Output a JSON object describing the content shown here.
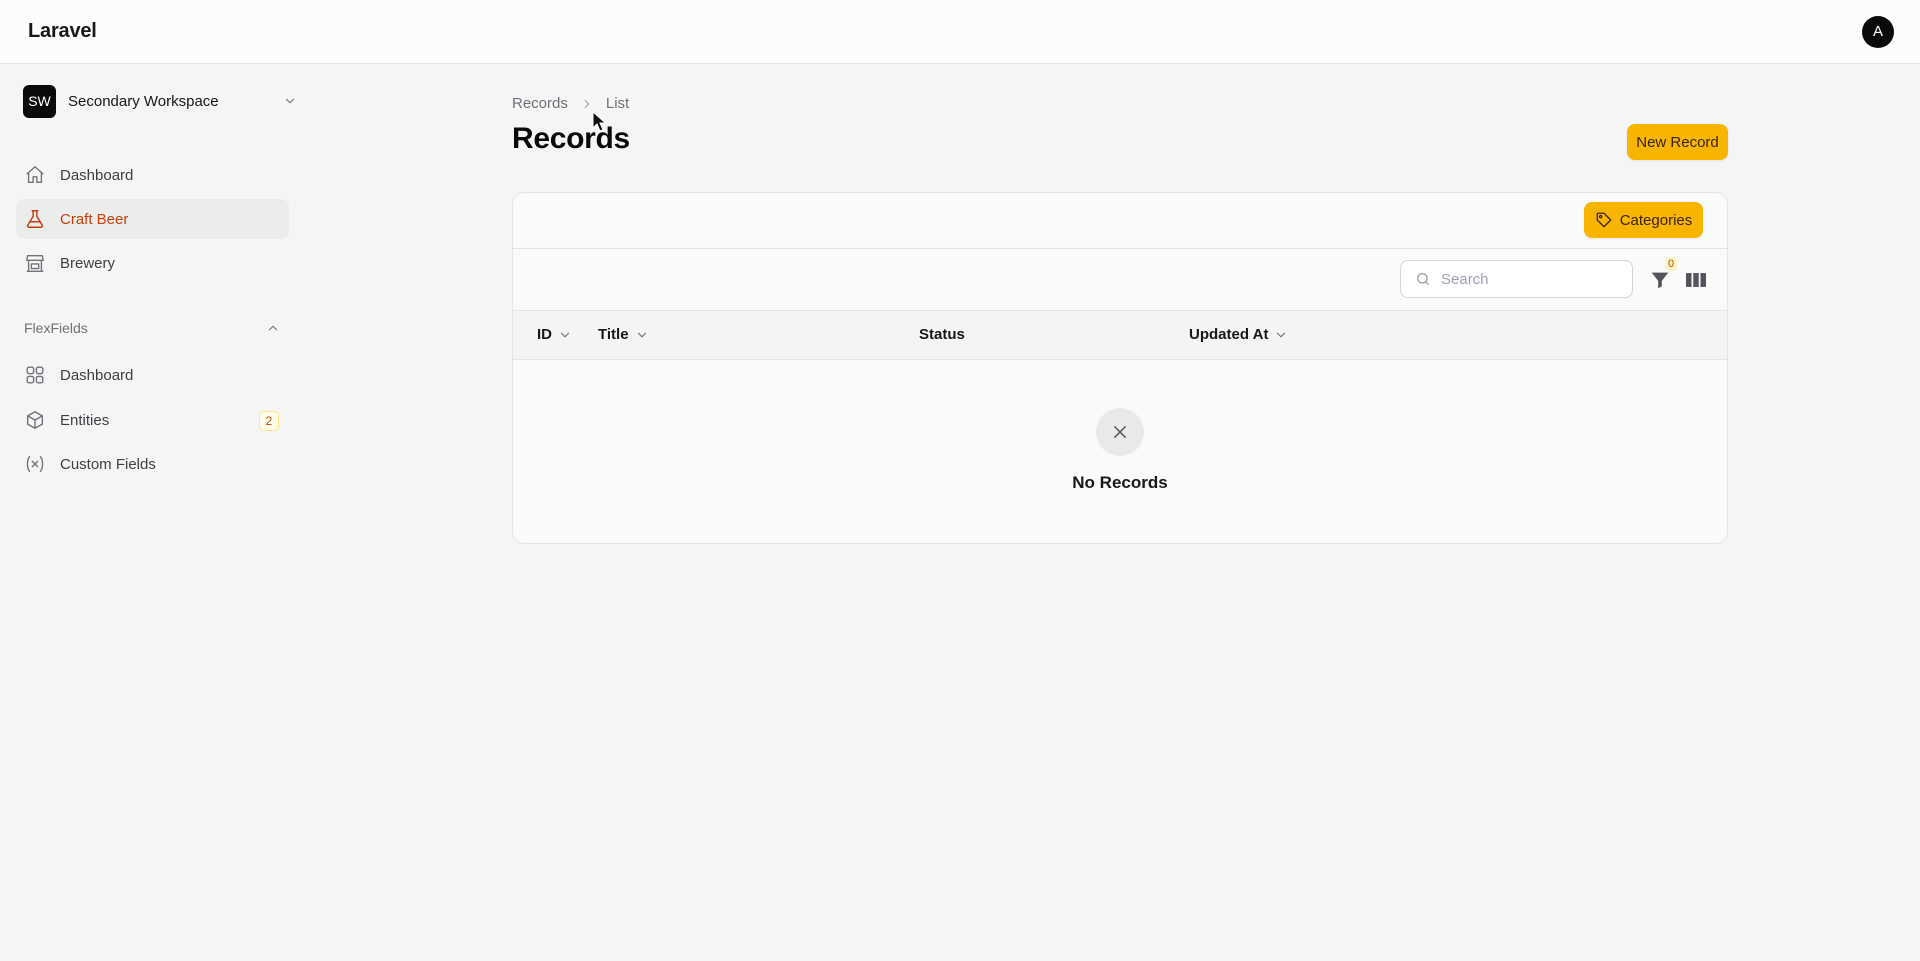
{
  "app": {
    "brand": "Laravel",
    "user_initial": "A"
  },
  "workspace": {
    "initials": "SW",
    "name": "Secondary Workspace"
  },
  "sidebar": {
    "items": [
      {
        "label": "Dashboard",
        "icon": "home-icon",
        "active": false
      },
      {
        "label": "Craft Beer",
        "icon": "flask-icon",
        "active": true
      },
      {
        "label": "Brewery",
        "icon": "building-store-icon",
        "active": false
      }
    ],
    "group": {
      "label": "FlexFields",
      "items": [
        {
          "label": "Dashboard",
          "icon": "grid-icon"
        },
        {
          "label": "Entities",
          "icon": "cube-icon",
          "badge": "2"
        },
        {
          "label": "Custom Fields",
          "icon": "variable-icon"
        }
      ]
    }
  },
  "breadcrumb": {
    "parent": "Records",
    "current": "List"
  },
  "page": {
    "title": "Records",
    "new_button": "New Record"
  },
  "table": {
    "categories_button": "Categories",
    "search_placeholder": "Search",
    "filter_count": "0",
    "columns": [
      {
        "label": "ID",
        "sortable": true
      },
      {
        "label": "Title",
        "sortable": true
      },
      {
        "label": "Status",
        "sortable": false
      },
      {
        "label": "Updated At",
        "sortable": true
      }
    ],
    "empty_text": "No Records"
  },
  "colors": {
    "accent": "#f8b500",
    "active_text": "#c2410c",
    "badge_text": "#b45309"
  }
}
